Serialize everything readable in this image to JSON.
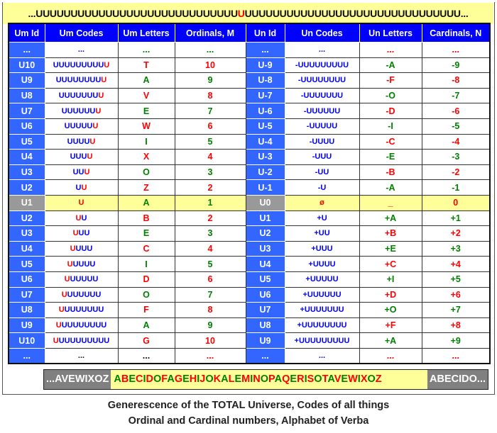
{
  "banner": {
    "left": "...UUUUUUUUUUUUUUUUUUUUUUUUUUUUU",
    "mid": "U",
    "right": "UUUUUUUUUUUUUUUUUUUUUUUUUUUUUUU..."
  },
  "headers": [
    "Um Id",
    "Um Codes",
    "Um Letters",
    "Ordinals, M",
    "Un Id",
    "Un Codes",
    "Un Letters",
    "Cardinals, N"
  ],
  "colors": {
    "header": "#0000ff",
    "id_cell": "#3366ff",
    "highlight": "#ffff99",
    "vowel": "#008000",
    "consonant": "#ff0000",
    "code": "#0000ff"
  },
  "rows": [
    {
      "id": "...",
      "code": [
        {
          "t": "...",
          "c": "b"
        }
      ],
      "letter": "...",
      "lc": "g",
      "ord": "...",
      "oc": "g",
      "uid": "...",
      "ucode": [
        {
          "t": "...",
          "c": "b"
        }
      ],
      "uletter": "...",
      "ulc": "r",
      "card": "...",
      "cc": "r"
    },
    {
      "id": "U10",
      "code": [
        {
          "t": "UUUUUUUUU",
          "c": "b"
        },
        {
          "t": "U",
          "c": "r"
        }
      ],
      "letter": "T",
      "lc": "r",
      "ord": "10",
      "oc": "r",
      "uid": "U-9",
      "ucode": [
        {
          "t": "-UUUUUUUUU",
          "c": "b"
        }
      ],
      "uletter": "-A",
      "ulc": "g",
      "card": "-9",
      "cc": "g"
    },
    {
      "id": "U9",
      "code": [
        {
          "t": "UUUUUUUU",
          "c": "b"
        },
        {
          "t": "U",
          "c": "r"
        }
      ],
      "letter": "A",
      "lc": "g",
      "ord": "9",
      "oc": "g",
      "uid": "U-8",
      "ucode": [
        {
          "t": "-UUUUUUUU",
          "c": "b"
        }
      ],
      "uletter": "-F",
      "ulc": "r",
      "card": "-8",
      "cc": "r"
    },
    {
      "id": "U8",
      "code": [
        {
          "t": "UUUUUUU",
          "c": "b"
        },
        {
          "t": "U",
          "c": "r"
        }
      ],
      "letter": "V",
      "lc": "r",
      "ord": "8",
      "oc": "r",
      "uid": "U-7",
      "ucode": [
        {
          "t": "-UUUUUUU",
          "c": "b"
        }
      ],
      "uletter": "-O",
      "ulc": "g",
      "card": "-7",
      "cc": "g"
    },
    {
      "id": "U7",
      "code": [
        {
          "t": "UUUUUU",
          "c": "b"
        },
        {
          "t": "U",
          "c": "r"
        }
      ],
      "letter": "E",
      "lc": "g",
      "ord": "7",
      "oc": "g",
      "uid": "U-6",
      "ucode": [
        {
          "t": "-UUUUUU",
          "c": "b"
        }
      ],
      "uletter": "-D",
      "ulc": "r",
      "card": "-6",
      "cc": "r"
    },
    {
      "id": "U6",
      "code": [
        {
          "t": "UUUUU",
          "c": "b"
        },
        {
          "t": "U",
          "c": "r"
        }
      ],
      "letter": "W",
      "lc": "r",
      "ord": "6",
      "oc": "r",
      "uid": "U-5",
      "ucode": [
        {
          "t": "-UUUUU",
          "c": "b"
        }
      ],
      "uletter": "-I",
      "ulc": "g",
      "card": "-5",
      "cc": "g"
    },
    {
      "id": "U5",
      "code": [
        {
          "t": "UUUU",
          "c": "b"
        },
        {
          "t": "U",
          "c": "r"
        }
      ],
      "letter": "I",
      "lc": "g",
      "ord": "5",
      "oc": "g",
      "uid": "U-4",
      "ucode": [
        {
          "t": "-UUUU",
          "c": "b"
        }
      ],
      "uletter": "-C",
      "ulc": "r",
      "card": "-4",
      "cc": "r"
    },
    {
      "id": "U4",
      "code": [
        {
          "t": "UUU",
          "c": "b"
        },
        {
          "t": "U",
          "c": "r"
        }
      ],
      "letter": "X",
      "lc": "r",
      "ord": "4",
      "oc": "r",
      "uid": "U-3",
      "ucode": [
        {
          "t": "-UUU",
          "c": "b"
        }
      ],
      "uletter": "-E",
      "ulc": "g",
      "card": "-3",
      "cc": "g"
    },
    {
      "id": "U3",
      "code": [
        {
          "t": "UU",
          "c": "b"
        },
        {
          "t": "U",
          "c": "r"
        }
      ],
      "letter": "O",
      "lc": "g",
      "ord": "3",
      "oc": "g",
      "uid": "U-2",
      "ucode": [
        {
          "t": "-UU",
          "c": "b"
        }
      ],
      "uletter": "-B",
      "ulc": "r",
      "card": "-2",
      "cc": "r"
    },
    {
      "id": "U2",
      "code": [
        {
          "t": "U",
          "c": "b"
        },
        {
          "t": "U",
          "c": "r"
        }
      ],
      "letter": "Z",
      "lc": "r",
      "ord": "2",
      "oc": "r",
      "uid": "U-1",
      "ucode": [
        {
          "t": "-U",
          "c": "b"
        }
      ],
      "uletter": "-A",
      "ulc": "g",
      "card": "-1",
      "cc": "g"
    },
    {
      "id": "U1",
      "hl": true,
      "code": [
        {
          "t": "U",
          "c": "r"
        }
      ],
      "letter": "A",
      "lc": "g",
      "ord": "1",
      "oc": "g",
      "uid": "U0",
      "ucode": [
        {
          "t": "ø",
          "c": "r"
        }
      ],
      "uletter": "_",
      "ulc": "r",
      "card": "0",
      "cc": "r"
    },
    {
      "id": "U2",
      "code": [
        {
          "t": "U",
          "c": "r"
        },
        {
          "t": "U",
          "c": "b"
        }
      ],
      "letter": "B",
      "lc": "r",
      "ord": "2",
      "oc": "r",
      "uid": "U1",
      "ucode": [
        {
          "t": "+U",
          "c": "b"
        }
      ],
      "uletter": "+A",
      "ulc": "g",
      "card": "+1",
      "cc": "g"
    },
    {
      "id": "U3",
      "code": [
        {
          "t": "U",
          "c": "r"
        },
        {
          "t": "UU",
          "c": "b"
        }
      ],
      "letter": "E",
      "lc": "g",
      "ord": "3",
      "oc": "g",
      "uid": "U2",
      "ucode": [
        {
          "t": "+UU",
          "c": "b"
        }
      ],
      "uletter": "+B",
      "ulc": "r",
      "card": "+2",
      "cc": "r"
    },
    {
      "id": "U4",
      "code": [
        {
          "t": "U",
          "c": "r"
        },
        {
          "t": "UUU",
          "c": "b"
        }
      ],
      "letter": "C",
      "lc": "r",
      "ord": "4",
      "oc": "r",
      "uid": "U3",
      "ucode": [
        {
          "t": "+UUU",
          "c": "b"
        }
      ],
      "uletter": "+E",
      "ulc": "g",
      "card": "+3",
      "cc": "g"
    },
    {
      "id": "U5",
      "code": [
        {
          "t": "U",
          "c": "r"
        },
        {
          "t": "UUUU",
          "c": "b"
        }
      ],
      "letter": "I",
      "lc": "g",
      "ord": "5",
      "oc": "g",
      "uid": "U4",
      "ucode": [
        {
          "t": "+UUUU",
          "c": "b"
        }
      ],
      "uletter": "+C",
      "ulc": "r",
      "card": "+4",
      "cc": "r"
    },
    {
      "id": "U6",
      "code": [
        {
          "t": "U",
          "c": "r"
        },
        {
          "t": "UUUUU",
          "c": "b"
        }
      ],
      "letter": "D",
      "lc": "r",
      "ord": "6",
      "oc": "r",
      "uid": "U5",
      "ucode": [
        {
          "t": "+UUUUU",
          "c": "b"
        }
      ],
      "uletter": "+I",
      "ulc": "g",
      "card": "+5",
      "cc": "g"
    },
    {
      "id": "U7",
      "code": [
        {
          "t": "U",
          "c": "r"
        },
        {
          "t": "UUUUUU",
          "c": "b"
        }
      ],
      "letter": "O",
      "lc": "g",
      "ord": "7",
      "oc": "g",
      "uid": "U6",
      "ucode": [
        {
          "t": "+UUUUUU",
          "c": "b"
        }
      ],
      "uletter": "+D",
      "ulc": "r",
      "card": "+6",
      "cc": "r"
    },
    {
      "id": "U8",
      "code": [
        {
          "t": "U",
          "c": "r"
        },
        {
          "t": "UUUUUUU",
          "c": "b"
        }
      ],
      "letter": "F",
      "lc": "r",
      "ord": "8",
      "oc": "r",
      "uid": "U7",
      "ucode": [
        {
          "t": "+UUUUUUU",
          "c": "b"
        }
      ],
      "uletter": "+O",
      "ulc": "g",
      "card": "+7",
      "cc": "g"
    },
    {
      "id": "U9",
      "code": [
        {
          "t": "U",
          "c": "r"
        },
        {
          "t": "UUUUUUUU",
          "c": "b"
        }
      ],
      "letter": "A",
      "lc": "g",
      "ord": "9",
      "oc": "g",
      "uid": "U8",
      "ucode": [
        {
          "t": "+UUUUUUUU",
          "c": "b"
        }
      ],
      "uletter": "+F",
      "ulc": "r",
      "card": "+8",
      "cc": "r"
    },
    {
      "id": "U10",
      "code": [
        {
          "t": "U",
          "c": "r"
        },
        {
          "t": "UUUUUUUUU",
          "c": "b"
        }
      ],
      "letter": "G",
      "lc": "r",
      "ord": "10",
      "oc": "r",
      "uid": "U9",
      "ucode": [
        {
          "t": "+UUUUUUUUU",
          "c": "b"
        }
      ],
      "uletter": "+A",
      "ulc": "g",
      "card": "+9",
      "cc": "g"
    },
    {
      "id": "...",
      "code": [
        {
          "t": "...",
          "c": "k"
        }
      ],
      "letter": "...",
      "lc": "k",
      "ord": "...",
      "oc": "r",
      "uid": "...",
      "ucode": [
        {
          "t": "...",
          "c": "b"
        }
      ],
      "uletter": "...",
      "ulc": "r",
      "card": "...",
      "cc": "r"
    }
  ],
  "alphabet": {
    "left": "...AVEWIXOZ",
    "right": "ABECIDO...",
    "letters": "ABECIDOFAGEHIJOKALEMINOPAQERISOTAVEWIXOZ",
    "vowels": "AEIO"
  },
  "caption": {
    "line1": "Generescence of the TOTAL Universe, Codes of all things",
    "line2": "Ordinal and Cardinal numbers, Alphabet of Verba"
  }
}
